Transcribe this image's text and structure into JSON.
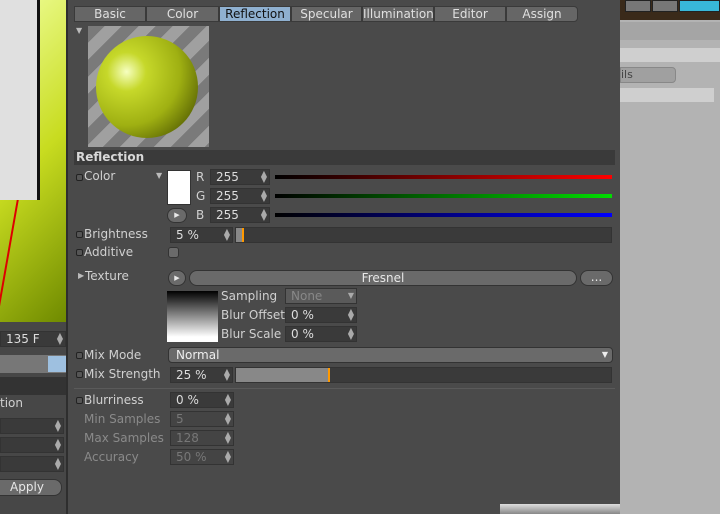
{
  "tabs": [
    "Basic",
    "Color",
    "Reflection",
    "Specular",
    "Illumination",
    "Editor",
    "Assign"
  ],
  "active_tab": "Reflection",
  "section_title": "Reflection",
  "color": {
    "label": "Color",
    "r_label": "R",
    "g_label": "G",
    "b_label": "B",
    "r": "255",
    "g": "255",
    "b": "255",
    "swatch": "#ffffff"
  },
  "brightness": {
    "label": "Brightness",
    "value": "5 %",
    "percent": 5
  },
  "additive": {
    "label": "Additive",
    "checked": false
  },
  "texture": {
    "label": "Texture",
    "shader": "Fresnel",
    "more": "...",
    "sampling_label": "Sampling",
    "sampling": "None",
    "blur_offset_label": "Blur Offset",
    "blur_offset": "0 %",
    "blur_scale_label": "Blur Scale",
    "blur_scale": "0 %"
  },
  "mix_mode": {
    "label": "Mix Mode",
    "value": "Normal"
  },
  "mix_strength": {
    "label": "Mix Strength",
    "value": "25 %",
    "percent": 25
  },
  "blurriness": {
    "label": "Blurriness",
    "value": "0 %"
  },
  "min_samples": {
    "label": "Min Samples",
    "value": "5"
  },
  "max_samples": {
    "label": "Max Samples",
    "value": "128"
  },
  "accuracy": {
    "label": "Accuracy",
    "value": "50 %"
  },
  "left": {
    "frame": "135 F",
    "section": "tion",
    "apply": "Apply"
  },
  "right": {
    "partial": "ils"
  },
  "accent": "#ff9900"
}
